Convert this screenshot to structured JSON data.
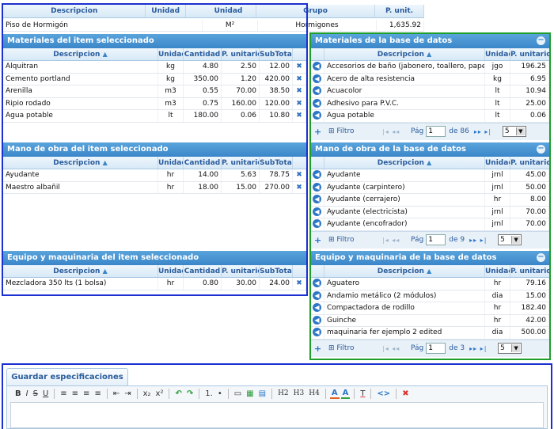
{
  "top_table": {
    "headers": [
      "Descripcion",
      "Unidad",
      "Grupo",
      "P. unit."
    ],
    "row": [
      "Piso de Hormigón",
      "M²",
      "Hormigones",
      "1,635.92"
    ]
  },
  "materiales_item": {
    "title": "Materiales del item seleccionado",
    "headers": [
      "Descripcion",
      "Unidad",
      "Cantidad",
      "P. unitario",
      "SubTotal"
    ],
    "rows": [
      [
        "Alquitran",
        "kg",
        "4.80",
        "2.50",
        "12.00"
      ],
      [
        "Cemento portland",
        "kg",
        "350.00",
        "1.20",
        "420.00"
      ],
      [
        "Arenilla",
        "m3",
        "0.55",
        "70.00",
        "38.50"
      ],
      [
        "Ripio rodado",
        "m3",
        "0.75",
        "160.00",
        "120.00"
      ],
      [
        "Agua potable",
        "lt",
        "180.00",
        "0.06",
        "10.80"
      ]
    ]
  },
  "mano_item": {
    "title": "Mano de obra del item seleccionado",
    "headers": [
      "Descripcion",
      "Unidad",
      "Cantidad",
      "P. unitario",
      "SubTotal"
    ],
    "rows": [
      [
        "Ayudante",
        "hr",
        "14.00",
        "5.63",
        "78.75"
      ],
      [
        "Maestro albañil",
        "hr",
        "18.00",
        "15.00",
        "270.00"
      ]
    ]
  },
  "equipo_item": {
    "title": "Equipo y maquinaria del item seleccionado",
    "headers": [
      "Descripcion",
      "Unidad",
      "Cantidad",
      "P. unitario",
      "SubTotal"
    ],
    "rows": [
      [
        "Mezcladora 350 lts (1 bolsa)",
        "hr",
        "0.80",
        "30.00",
        "24.00"
      ]
    ]
  },
  "materiales_db": {
    "title": "Materiales de la base de datos",
    "headers": [
      "Descripcion",
      "Unidad",
      "P. unitario"
    ],
    "rows": [
      [
        "Accesorios de baño (jabonero, toallero, papelero, p",
        "jgo",
        "196.25"
      ],
      [
        "Acero de alta resistencia",
        "kg",
        "6.95"
      ],
      [
        "Acuacolor",
        "lt",
        "10.94"
      ],
      [
        "Adhesivo para P.V.C.",
        "lt",
        "25.00"
      ],
      [
        "Agua potable",
        "lt",
        "0.06"
      ]
    ],
    "pager": {
      "filter": "Filtro",
      "page_label": "Pág",
      "page": "1",
      "of": "de 86",
      "size": "5"
    }
  },
  "mano_db": {
    "title": "Mano de obra de la base de datos",
    "headers": [
      "Descripcion",
      "Unidad",
      "P. unitario"
    ],
    "rows": [
      [
        "Ayudante",
        "jrnl",
        "45.00"
      ],
      [
        "Ayudante (carpintero)",
        "jrnl",
        "50.00"
      ],
      [
        "Ayudante (cerrajero)",
        "hr",
        "8.00"
      ],
      [
        "Ayudante (electricista)",
        "jrnl",
        "70.00"
      ],
      [
        "Ayudante (encofrador)",
        "jrnl",
        "70.00"
      ]
    ],
    "pager": {
      "filter": "Filtro",
      "page_label": "Pág",
      "page": "1",
      "of": "de 9",
      "size": "5"
    }
  },
  "equipo_db": {
    "title": "Equipo y maquinaria de la base de datos",
    "headers": [
      "Descripcion",
      "Unidad",
      "P. unitario"
    ],
    "rows": [
      [
        "Aguatero",
        "hr",
        "79.16"
      ],
      [
        "Andamio metálico (2 módulos)",
        "dia",
        "15.00"
      ],
      [
        "Compactadora de rodillo",
        "hr",
        "182.40"
      ],
      [
        "Guinche",
        "hr",
        "42.00"
      ],
      [
        "maquinaria fer ejemplo 2 edited",
        "dia",
        "500.00"
      ]
    ],
    "pager": {
      "filter": "Filtro",
      "page_label": "Pág",
      "page": "1",
      "of": "de 3",
      "size": "5"
    }
  },
  "specs": {
    "tab_label": "Guardar especificaciones",
    "toolbar": [
      "B",
      "I",
      "S",
      "U",
      "≡",
      "≡",
      "≡",
      "≡",
      "⇤",
      "⇥",
      "x₂",
      "x²",
      "↶",
      "↷",
      "1.",
      "•",
      "▭",
      "▦",
      "▤",
      "H2",
      "H3",
      "H4",
      "A",
      "A",
      "T",
      "<>",
      "✖"
    ]
  }
}
